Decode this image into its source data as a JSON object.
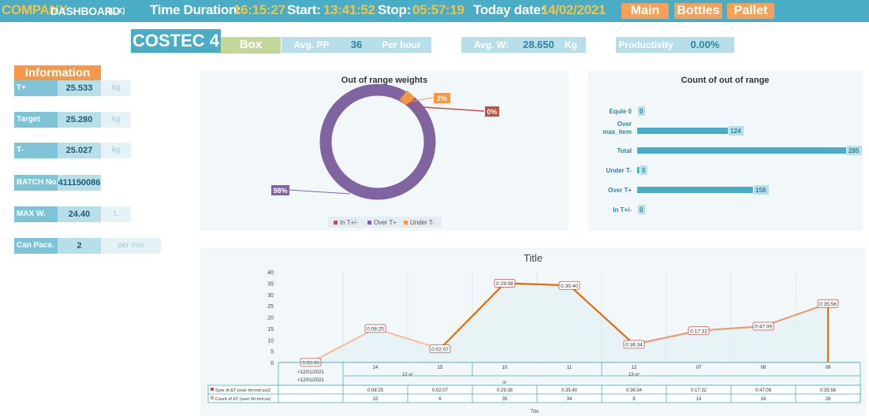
{
  "header": {
    "company": "COMPANY",
    "dashboard": "DASHBOARD",
    "dashboard_suffix": "(L.K)",
    "duration_label": "Time Duration:",
    "duration_value": "16:15:27",
    "start_label": "Start:",
    "start_value": "13:41:52",
    "stop_label": "Stop:",
    "stop_value": "05:57:19",
    "today_label": "Today date:",
    "today_value": "14/02/2021",
    "nav": [
      "Main",
      "Bottles",
      "Pallet"
    ]
  },
  "kpi": {
    "machine": "COSTEC 4",
    "mode": "Box",
    "avg_pp_label": "Avg. PP",
    "avg_pp_value": "36",
    "avg_pp_unit": "Per hour",
    "avg_w_label": "Avg. W:",
    "avg_w_value": "28.650",
    "avg_w_unit": "Kg",
    "productivity_label": "Productivity",
    "productivity_value": "0.00%"
  },
  "info": {
    "title": "Information",
    "rows": [
      {
        "label": "T+",
        "value": "25.533",
        "unit": "kg"
      },
      {
        "label": "Target",
        "value": "25.280",
        "unit": "kg"
      },
      {
        "label": "T-",
        "value": "25.027",
        "unit": "kg"
      },
      {
        "label": "BATCH No.",
        "value": "411150086",
        "unit": ""
      },
      {
        "label": "MAX W.",
        "value": "24.40",
        "unit": "L"
      },
      {
        "label": "Can Pace.",
        "value": "2",
        "unit": "per min"
      }
    ]
  },
  "donut": {
    "title": "Out of range weights",
    "labels": [
      "2%",
      "0%",
      "98%"
    ],
    "legend": [
      "In T+/-",
      "Over T+",
      "Under T-"
    ],
    "colors": {
      "in": "#c0504d",
      "over": "#8064a2",
      "under": "#f79646"
    }
  },
  "bar": {
    "title": "Count of out of range",
    "rows": [
      {
        "label": "Equle 0",
        "value": "0"
      },
      {
        "label": "Over max_item",
        "value": "124"
      },
      {
        "label": "Total",
        "value": "285"
      },
      {
        "label": "Under T-",
        "value": "3"
      },
      {
        "label": "Over T+",
        "value": "158"
      },
      {
        "label": "In T+/-",
        "value": "0"
      }
    ]
  },
  "chart_data": [
    {
      "type": "pie",
      "title": "Out of range weights",
      "categories": [
        "In T+/-",
        "Over T+",
        "Under T-"
      ],
      "values": [
        0,
        98,
        2
      ]
    },
    {
      "type": "bar",
      "title": "Count of out of range",
      "categories": [
        "Equle 0",
        "Over max_item",
        "Total",
        "Under T-",
        "Over T+",
        "In T+/-"
      ],
      "values": [
        0,
        124,
        285,
        3,
        158,
        0
      ]
    },
    {
      "type": "line",
      "title": "Title",
      "xlabel": "Title",
      "ylim": [
        0,
        40
      ],
      "yticks": [
        "0",
        "5",
        "10",
        "15",
        "20",
        "25",
        "30",
        "35",
        "40"
      ],
      "x": [
        "<12/01/2021",
        "14",
        "15",
        "10",
        "11",
        "12",
        "07",
        "08",
        "09"
      ],
      "groups": [
        "12-ינו",
        "13-ינו"
      ],
      "group_sub": "ינו",
      "first_x_sub": "<12/01/2021",
      "series": [
        {
          "name": "Sum of ΔT (over hh:mm:ss)2",
          "values": [
            "0:00:00",
            "0:08:25",
            "0:02:07",
            "0:29:38",
            "0:35:40",
            "0:36:34",
            "0:17:32",
            "0:47:09",
            "0:35:56"
          ]
        },
        {
          "name": "Count of ΔT (over hh:mm:ss)",
          "values": [
            0,
            15,
            6,
            35,
            34,
            8,
            14,
            16,
            26
          ]
        }
      ]
    }
  ]
}
